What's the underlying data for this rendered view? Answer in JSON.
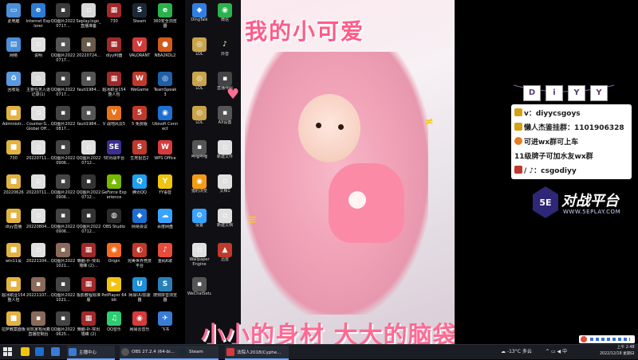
{
  "desktop_icons": [
    {
      "label": "此电脑",
      "color": "#4a8fd8",
      "glyph": "▭"
    },
    {
      "label": "Internet Explorer",
      "color": "#2f7bd4",
      "glyph": "e"
    },
    {
      "label": "QQ图片20220717...",
      "color": "#3b3b3b",
      "glyph": "▪"
    },
    {
      "label": "Seplay.logo_直播准备",
      "color": "#d8d8d8",
      "glyph": "▫"
    },
    {
      "label": "730",
      "color": "#a02a2a",
      "glyph": "▦"
    },
    {
      "label": "Steam",
      "color": "#1b2838",
      "glyph": "S"
    },
    {
      "label": "360安全浏览器",
      "color": "#2bb24c",
      "glyph": "e"
    },
    {
      "label": "网络",
      "color": "#4a8fd8",
      "glyph": "▤"
    },
    {
      "label": "说明",
      "color": "#e0e0e0",
      "glyph": "▫"
    },
    {
      "label": "QQ图片20220717...",
      "color": "#555",
      "glyph": "▪"
    },
    {
      "label": "20220724...",
      "color": "#6a5a4a",
      "glyph": "▪"
    },
    {
      "label": "diyy利器",
      "color": "#a02a2a",
      "glyph": "▦"
    },
    {
      "label": "VALORANT",
      "color": "#d23b3b",
      "glyph": "V"
    },
    {
      "label": "NBA2KOL2",
      "color": "#d25a1b",
      "glyph": "●"
    },
    {
      "label": "回收站",
      "color": "#5a9ae0",
      "glyph": "♻"
    },
    {
      "label": "主要任务入道记录(1)",
      "color": "#d8d8d8",
      "glyph": "▫"
    },
    {
      "label": "QQ图片20220717...",
      "color": "#444",
      "glyph": "▪"
    },
    {
      "label": "fauti1984...",
      "color": "#555",
      "glyph": "▪"
    },
    {
      "label": "超冰职业154整人包",
      "color": "#a02a2a",
      "glyph": "▦"
    },
    {
      "label": "WeGame",
      "color": "#c0392b",
      "glyph": "W"
    },
    {
      "label": "TeamSpeak 3",
      "color": "#1f5fa8",
      "glyph": "◎"
    },
    {
      "label": "Administr...",
      "color": "#e3b341",
      "glyph": "■"
    },
    {
      "label": "Counter-S... Global Off...",
      "color": "#e0e0e0",
      "glyph": "▫"
    },
    {
      "label": "QQ图片20220817...",
      "color": "#444",
      "glyph": "▪"
    },
    {
      "label": "fauti1984...",
      "color": "#555",
      "glyph": "▪"
    },
    {
      "label": "V 战地风云5",
      "color": "#e8731a",
      "glyph": "V"
    },
    {
      "label": "5 免费版",
      "color": "#c0392b",
      "glyph": "5"
    },
    {
      "label": "Ubisoft Connect",
      "color": "#1d6fd1",
      "glyph": "◉"
    },
    {
      "label": "730",
      "color": "#e3b341",
      "glyph": "■"
    },
    {
      "label": "20220711...",
      "color": "#e0e0e0",
      "glyph": "▫"
    },
    {
      "label": "QQ图片20220906...",
      "color": "#444",
      "glyph": "▪"
    },
    {
      "label": "QQ图片20220712...",
      "color": "#e0e0e0",
      "glyph": "▫"
    },
    {
      "label": "5E对战平台",
      "color": "#3b2e8f",
      "glyph": "SE"
    },
    {
      "label": "生死狙击2",
      "color": "#c0392b",
      "glyph": "S"
    },
    {
      "label": "WPS Office",
      "color": "#d63b3b",
      "glyph": "W"
    },
    {
      "label": "20220626",
      "color": "#e3b341",
      "glyph": "■"
    },
    {
      "label": "20220711...",
      "color": "#e0e0e0",
      "glyph": "▫"
    },
    {
      "label": "QQ图片20220906...",
      "color": "#444",
      "glyph": "▪"
    },
    {
      "label": "QQ图片20220712...",
      "color": "#333",
      "glyph": "▪"
    },
    {
      "label": "GeForce Experience",
      "color": "#76b900",
      "glyph": "▲"
    },
    {
      "label": "腾讯QQ",
      "color": "#1da1f2",
      "glyph": "Q"
    },
    {
      "label": "YY语音",
      "color": "#f1c40f",
      "glyph": "Y"
    },
    {
      "label": "diyy直播",
      "color": "#e3b341",
      "glyph": "■"
    },
    {
      "label": "20220804...",
      "color": "#e0e0e0",
      "glyph": "▫"
    },
    {
      "label": "QQ图片20220906...",
      "color": "#444",
      "glyph": "▪"
    },
    {
      "label": "QQ图片20220712...",
      "color": "#333",
      "glyph": "▪"
    },
    {
      "label": "OBS Studio",
      "color": "#2b2b2b",
      "glyph": "◍"
    },
    {
      "label": "网易会议",
      "color": "#1d6fd1",
      "glyph": "◆"
    },
    {
      "label": "百度网盘",
      "color": "#3aa3ff",
      "glyph": "☁"
    },
    {
      "label": "win11设",
      "color": "#e3b341",
      "glyph": "■"
    },
    {
      "label": "20221104...",
      "color": "#e0e0e0",
      "glyph": "▫"
    },
    {
      "label": "QQ图片20221021...",
      "color": "#8a6a5a",
      "glyph": "▪"
    },
    {
      "label": "懒脑-扑-突出墙峰 (2)...",
      "color": "#a02a2a",
      "glyph": "▦"
    },
    {
      "label": "Origin",
      "color": "#f26c22",
      "glyph": "◉"
    },
    {
      "label": "完美世界竞技平台",
      "color": "#c0392b",
      "glyph": "◐"
    },
    {
      "label": "金码K歌",
      "color": "#e74c3c",
      "glyph": "♪"
    },
    {
      "label": "超冰职业154整人包",
      "color": "#e3b341",
      "glyph": "■"
    },
    {
      "label": "20221107...",
      "color": "#8a6a5a",
      "glyph": "▪"
    },
    {
      "label": "QQ图片20221021...",
      "color": "#444",
      "glyph": "▪"
    },
    {
      "label": "极影教程标准版",
      "color": "#a02a2a",
      "glyph": "▦"
    },
    {
      "label": "PotPlayer 64 bit",
      "color": "#f1c40f",
      "glyph": "▶"
    },
    {
      "label": "网易UU加速器",
      "color": "#1f8fd8",
      "glyph": "U"
    },
    {
      "label": "搜狗拼音浏览器",
      "color": "#2980b9",
      "glyph": "S"
    },
    {
      "label": "拉萨教案面板",
      "color": "#e3b341",
      "glyph": "■"
    },
    {
      "label": "昆玖家有闲着直播控制台",
      "color": "#8a6a5a",
      "glyph": "▪"
    },
    {
      "label": "QQ图片20220625...",
      "color": "#444",
      "glyph": "▪"
    },
    {
      "label": "懒脑-扑-突出墙峰 (2)",
      "color": "#a02a2a",
      "glyph": "▦"
    },
    {
      "label": "QQ音乐",
      "color": "#2ecc71",
      "glyph": "♫"
    },
    {
      "label": "网易云音乐",
      "color": "#d63b3b",
      "glyph": "◉"
    },
    {
      "label": "飞书",
      "color": "#3b7bd8",
      "glyph": "✈"
    }
  ],
  "wallpaper_icons": [
    {
      "label": "DingTalk",
      "color": "#2f7fe3",
      "glyph": "◆"
    },
    {
      "label": "微信",
      "color": "#2bb24c",
      "glyph": "◉"
    },
    {
      "label": "LOL",
      "color": "#c9a44a",
      "glyph": "◎"
    },
    {
      "label": "抖音",
      "color": "#111",
      "glyph": "♪"
    },
    {
      "label": "LOL",
      "color": "#c9a44a",
      "glyph": "◎"
    },
    {
      "label": "直播伴侣",
      "color": "#444",
      "glyph": "▪"
    },
    {
      "label": "LOL",
      "color": "#c9a44a",
      "glyph": "◎"
    },
    {
      "label": "AX设置",
      "color": "#555",
      "glyph": "▪"
    },
    {
      "label": "哔哩哔哩",
      "color": "#555",
      "glyph": "▪"
    },
    {
      "label": "新建文件",
      "color": "#e0e0e0",
      "glyph": "▫"
    },
    {
      "label": "猎豹浏览",
      "color": "#f39c12",
      "glyph": "◉"
    },
    {
      "label": "文档1",
      "color": "#e0e0e0",
      "glyph": "▫"
    },
    {
      "label": "设置",
      "color": "#3aa3ff",
      "glyph": "⚙"
    },
    {
      "label": "新建文档",
      "color": "#e0e0e0",
      "glyph": "▫"
    },
    {
      "label": "Wallpaper Engine",
      "color": "#e0e0e0",
      "glyph": "▫"
    },
    {
      "label": "迅雷",
      "color": "#c0392b",
      "glyph": "▲"
    },
    {
      "label": "WeChatSetup",
      "color": "#555",
      "glyph": "▪"
    }
  ],
  "wallpaper": {
    "title": "我的小可爱",
    "bottom_text": "小小的身材 大大的脑袋"
  },
  "overlay": {
    "sign_letters": [
      "D",
      "i",
      "Y",
      "Y"
    ],
    "rows": [
      {
        "text": "v：diyycsgoys",
        "icon_color": "#d4a017"
      },
      {
        "text": "懒人杰鉴挂群：1101906328",
        "icon_color": "#d4a017"
      },
      {
        "text": "可进wx群可上车",
        "icon_color": "#e67e22"
      },
      {
        "text": "11级牌子可加水友wx群",
        "icon_color": "#ffffff"
      },
      {
        "text": "/ ♪：csgodiyy",
        "icon_color": "#c0392b"
      }
    ],
    "logo_mark": "5E",
    "logo_name": "对战平台",
    "logo_url": "WWW.5EPLAY.COM"
  },
  "taskbar": {
    "apps": [
      {
        "label": "主播中心",
        "color": "#3b7bd8"
      },
      {
        "label": "OBS 27.2.4 (64-bi...",
        "color": "#2b2b2b"
      },
      {
        "label": "Steam",
        "color": "#1b2838"
      },
      {
        "label": "法院人2018(Cyphe...",
        "color": "#d63b3b"
      }
    ],
    "weather": "-13°C 多云",
    "time": "上午 2:48",
    "date": "2022/12/18 星期日"
  }
}
